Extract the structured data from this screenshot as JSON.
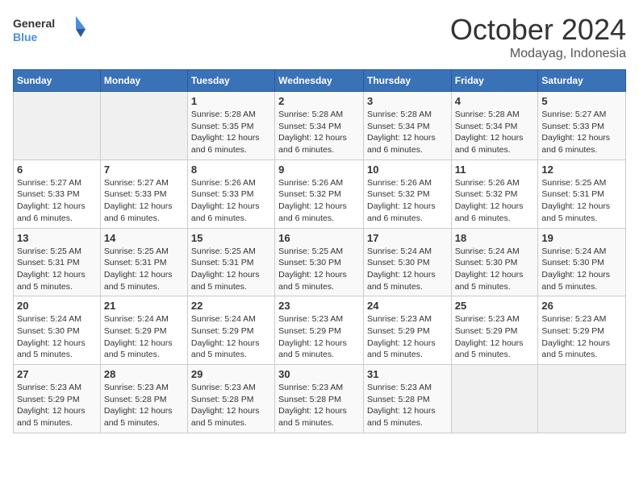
{
  "logo": {
    "line1": "General",
    "line2": "Blue"
  },
  "title": "October 2024",
  "subtitle": "Modayag, Indonesia",
  "days_of_week": [
    "Sunday",
    "Monday",
    "Tuesday",
    "Wednesday",
    "Thursday",
    "Friday",
    "Saturday"
  ],
  "weeks": [
    [
      {
        "day": "",
        "info": ""
      },
      {
        "day": "",
        "info": ""
      },
      {
        "day": "1",
        "info": "Sunrise: 5:28 AM\nSunset: 5:35 PM\nDaylight: 12 hours and 6 minutes."
      },
      {
        "day": "2",
        "info": "Sunrise: 5:28 AM\nSunset: 5:34 PM\nDaylight: 12 hours and 6 minutes."
      },
      {
        "day": "3",
        "info": "Sunrise: 5:28 AM\nSunset: 5:34 PM\nDaylight: 12 hours and 6 minutes."
      },
      {
        "day": "4",
        "info": "Sunrise: 5:28 AM\nSunset: 5:34 PM\nDaylight: 12 hours and 6 minutes."
      },
      {
        "day": "5",
        "info": "Sunrise: 5:27 AM\nSunset: 5:33 PM\nDaylight: 12 hours and 6 minutes."
      }
    ],
    [
      {
        "day": "6",
        "info": "Sunrise: 5:27 AM\nSunset: 5:33 PM\nDaylight: 12 hours and 6 minutes."
      },
      {
        "day": "7",
        "info": "Sunrise: 5:27 AM\nSunset: 5:33 PM\nDaylight: 12 hours and 6 minutes."
      },
      {
        "day": "8",
        "info": "Sunrise: 5:26 AM\nSunset: 5:33 PM\nDaylight: 12 hours and 6 minutes."
      },
      {
        "day": "9",
        "info": "Sunrise: 5:26 AM\nSunset: 5:32 PM\nDaylight: 12 hours and 6 minutes."
      },
      {
        "day": "10",
        "info": "Sunrise: 5:26 AM\nSunset: 5:32 PM\nDaylight: 12 hours and 6 minutes."
      },
      {
        "day": "11",
        "info": "Sunrise: 5:26 AM\nSunset: 5:32 PM\nDaylight: 12 hours and 6 minutes."
      },
      {
        "day": "12",
        "info": "Sunrise: 5:25 AM\nSunset: 5:31 PM\nDaylight: 12 hours and 5 minutes."
      }
    ],
    [
      {
        "day": "13",
        "info": "Sunrise: 5:25 AM\nSunset: 5:31 PM\nDaylight: 12 hours and 5 minutes."
      },
      {
        "day": "14",
        "info": "Sunrise: 5:25 AM\nSunset: 5:31 PM\nDaylight: 12 hours and 5 minutes."
      },
      {
        "day": "15",
        "info": "Sunrise: 5:25 AM\nSunset: 5:31 PM\nDaylight: 12 hours and 5 minutes."
      },
      {
        "day": "16",
        "info": "Sunrise: 5:25 AM\nSunset: 5:30 PM\nDaylight: 12 hours and 5 minutes."
      },
      {
        "day": "17",
        "info": "Sunrise: 5:24 AM\nSunset: 5:30 PM\nDaylight: 12 hours and 5 minutes."
      },
      {
        "day": "18",
        "info": "Sunrise: 5:24 AM\nSunset: 5:30 PM\nDaylight: 12 hours and 5 minutes."
      },
      {
        "day": "19",
        "info": "Sunrise: 5:24 AM\nSunset: 5:30 PM\nDaylight: 12 hours and 5 minutes."
      }
    ],
    [
      {
        "day": "20",
        "info": "Sunrise: 5:24 AM\nSunset: 5:30 PM\nDaylight: 12 hours and 5 minutes."
      },
      {
        "day": "21",
        "info": "Sunrise: 5:24 AM\nSunset: 5:29 PM\nDaylight: 12 hours and 5 minutes."
      },
      {
        "day": "22",
        "info": "Sunrise: 5:24 AM\nSunset: 5:29 PM\nDaylight: 12 hours and 5 minutes."
      },
      {
        "day": "23",
        "info": "Sunrise: 5:23 AM\nSunset: 5:29 PM\nDaylight: 12 hours and 5 minutes."
      },
      {
        "day": "24",
        "info": "Sunrise: 5:23 AM\nSunset: 5:29 PM\nDaylight: 12 hours and 5 minutes."
      },
      {
        "day": "25",
        "info": "Sunrise: 5:23 AM\nSunset: 5:29 PM\nDaylight: 12 hours and 5 minutes."
      },
      {
        "day": "26",
        "info": "Sunrise: 5:23 AM\nSunset: 5:29 PM\nDaylight: 12 hours and 5 minutes."
      }
    ],
    [
      {
        "day": "27",
        "info": "Sunrise: 5:23 AM\nSunset: 5:29 PM\nDaylight: 12 hours and 5 minutes."
      },
      {
        "day": "28",
        "info": "Sunrise: 5:23 AM\nSunset: 5:28 PM\nDaylight: 12 hours and 5 minutes."
      },
      {
        "day": "29",
        "info": "Sunrise: 5:23 AM\nSunset: 5:28 PM\nDaylight: 12 hours and 5 minutes."
      },
      {
        "day": "30",
        "info": "Sunrise: 5:23 AM\nSunset: 5:28 PM\nDaylight: 12 hours and 5 minutes."
      },
      {
        "day": "31",
        "info": "Sunrise: 5:23 AM\nSunset: 5:28 PM\nDaylight: 12 hours and 5 minutes."
      },
      {
        "day": "",
        "info": ""
      },
      {
        "day": "",
        "info": ""
      }
    ]
  ]
}
